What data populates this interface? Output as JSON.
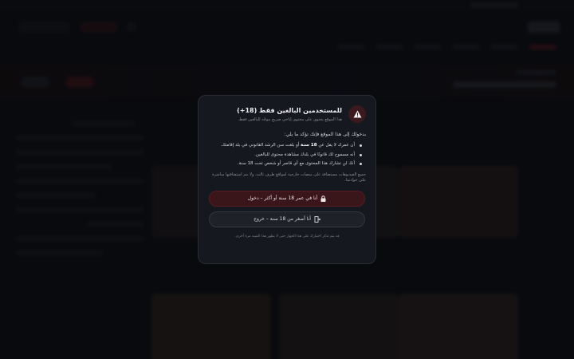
{
  "modal": {
    "title": "للمستخدمين البالغين فقط (18+)",
    "subtitle": "هذا الموقع يحتوي على محتوى إباحي صريح موجّه للبالغين فقط.",
    "intro": "بدخولك إلى هذا الموقع فإنك تؤكد ما يلي:",
    "items": [
      {
        "pre": "أن عمرك لا يقل عن ",
        "bold": "18 سنة",
        "post": " أو بلغت سن الرشد القانوني في بلد إقامتك."
      },
      {
        "text": "أنه مسموح لك قانونًا في بلدك مشاهدة محتوى للبالغين."
      },
      {
        "text": "أنك لن تشارك هذا المحتوى مع أي قاصر أو شخص تحت 18 سنة."
      }
    ],
    "note": "جميع الفيديوهات مستضافة على منصات خارجية لمواقع طرف ثالث، ولا يتم استضافتها مباشرة على خوادمنا.",
    "enter_label": "أنا في عمر 18 سنة أو أكثر – دخول",
    "exit_label": "أنا أصغر من 18 سنة – خروج",
    "footer": "قد يتم تذكر اختيارك على هذا الجهاز حتى لا يظهر هذا التنبيه مرة أخرى.",
    "icons": {
      "badge": "warning-icon",
      "enter": "lock-icon",
      "exit": "exit-door-icon"
    },
    "colors": {
      "accent": "#e8414f",
      "enter_bg": "#3a1519",
      "exit_bg": "#1f2129",
      "modal_bg": "#16181f"
    }
  }
}
